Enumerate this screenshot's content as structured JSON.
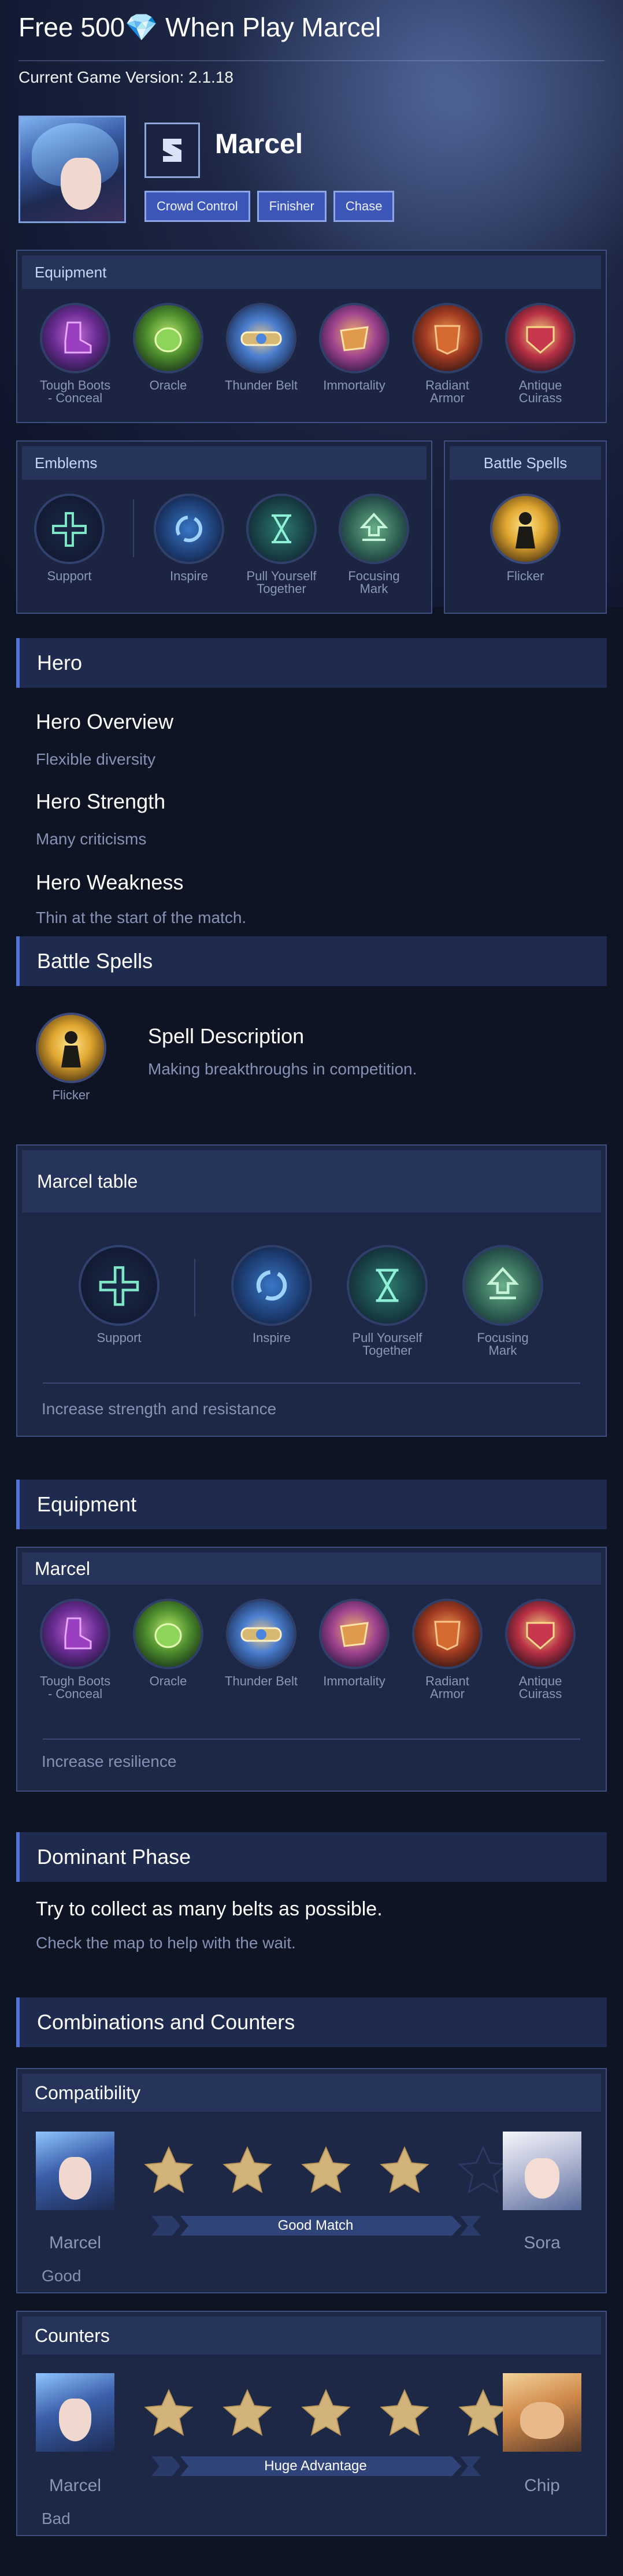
{
  "header": {
    "title": "Free 500💎 When Play Marcel",
    "version": "Current Game Version: 2.1.18"
  },
  "hero": {
    "name": "Marcel",
    "tags": [
      "Crowd Control",
      "Finisher",
      "Chase"
    ]
  },
  "equipment_panel": {
    "title": "Equipment",
    "items": [
      "Tough Boots - Conceal",
      "Oracle",
      "Thunder Belt",
      "Immortality",
      "Radiant Armor",
      "Antique Cuirass"
    ]
  },
  "emblems_panel": {
    "title": "Emblems",
    "main": "Support",
    "talents": [
      "Inspire",
      "Pull Yourself Together",
      "Focusing Mark"
    ]
  },
  "spells_panel": {
    "title": "Battle Spells",
    "spell": "Flicker"
  },
  "hero_section": {
    "title": "Hero",
    "overview_title": "Hero Overview",
    "overview_text": "Flexible diversity",
    "strength_title": "Hero Strength",
    "strength_text": "Many criticisms",
    "weakness_title": "Hero Weakness",
    "weakness_text": "Thin at the start of the match."
  },
  "battle_spells_section": {
    "title": "Battle Spells",
    "spell": "Flicker",
    "desc_title": "Spell Description",
    "desc_text": "Making breakthroughs in competition."
  },
  "marcel_table": {
    "title": "Marcel table",
    "main": "Support",
    "talents": [
      "Inspire",
      "Pull Yourself Together",
      "Focusing Mark"
    ],
    "note": "Increase strength and resistance"
  },
  "equipment_section": {
    "title": "Equipment",
    "subtitle": "Marcel",
    "items": [
      "Tough Boots - Conceal",
      "Oracle",
      "Thunder Belt",
      "Immortality",
      "Radiant Armor",
      "Antique Cuirass"
    ],
    "note": "Increase resilience"
  },
  "dominant_phase": {
    "title": "Dominant Phase",
    "headline": "Try to collect as many belts as possible.",
    "text": "Check the map to help with the wait."
  },
  "combos": {
    "title": "Combinations and Counters",
    "compat": {
      "title": "Compatibility",
      "hero": "Marcel",
      "partner": "Sora",
      "rating": 4,
      "max": 5,
      "label": "Good Match",
      "verdict": "Good"
    },
    "counters": {
      "title": "Counters",
      "hero": "Marcel",
      "partner": "Chip",
      "rating": 5,
      "max": 5,
      "label": "Huge Advantage",
      "verdict": "Bad"
    }
  },
  "colors": {
    "accent": "#4f76d8",
    "star": "#d2b47a",
    "bg": "#0f1424",
    "panel": "#1b2440"
  },
  "icons": [
    "boots-icon",
    "oracle-icon",
    "thunder-belt-icon",
    "immortality-icon",
    "radiant-armor-icon",
    "antique-cuirass-icon",
    "support-emblem-icon",
    "inspire-icon",
    "pull-yourself-together-icon",
    "focusing-mark-icon",
    "flicker-icon",
    "star-icon"
  ]
}
